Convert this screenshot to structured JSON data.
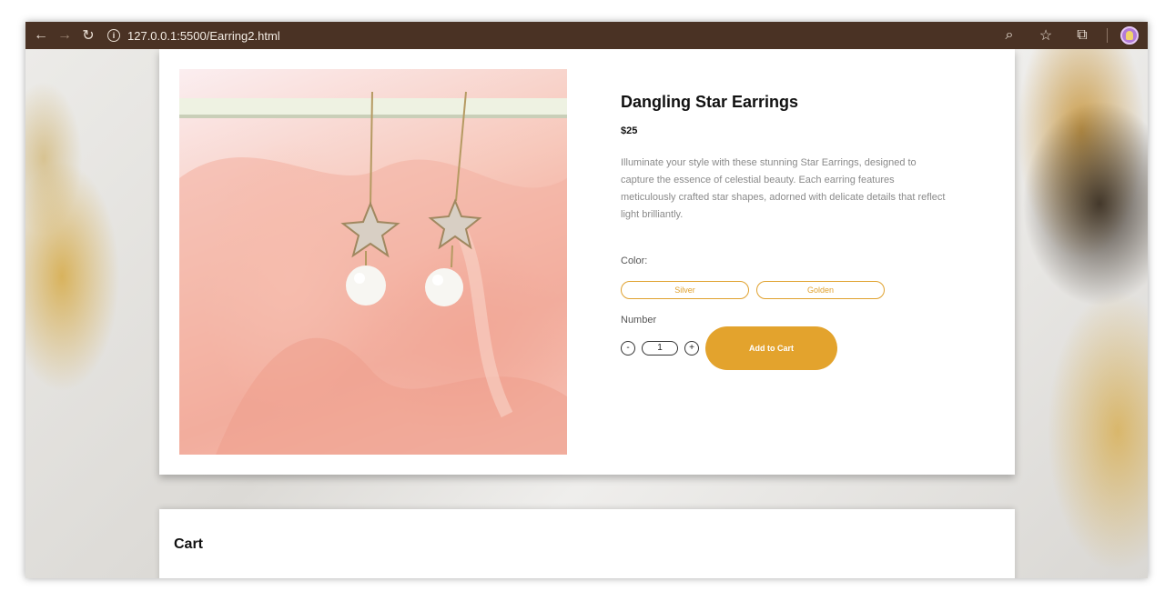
{
  "browser": {
    "url": "127.0.0.1:5500/Earring2.html",
    "back_glyph": "←",
    "forward_glyph": "→",
    "reload_glyph": "↻",
    "zoom_glyph": "⌕",
    "star_glyph": "☆",
    "extensions_glyph": "⧉",
    "info_glyph": "i"
  },
  "product": {
    "title": "Dangling Star Earrings",
    "price": "$25",
    "description": "Illuminate your style with these stunning Star Earrings, designed to capture the essence of celestial beauty. Each earring features meticulously crafted star shapes, adorned with delicate details that reflect light brilliantly.",
    "color_label": "Color:",
    "colors": [
      "Silver",
      "Golden"
    ],
    "number_label": "Number",
    "quantity": "1",
    "decrement": "-",
    "increment": "+",
    "add_to_cart": "Add to Cart"
  },
  "cart": {
    "title": "Cart"
  },
  "theme": {
    "toolbar_bg": "#4a3224",
    "accent": "#e3a32d"
  }
}
